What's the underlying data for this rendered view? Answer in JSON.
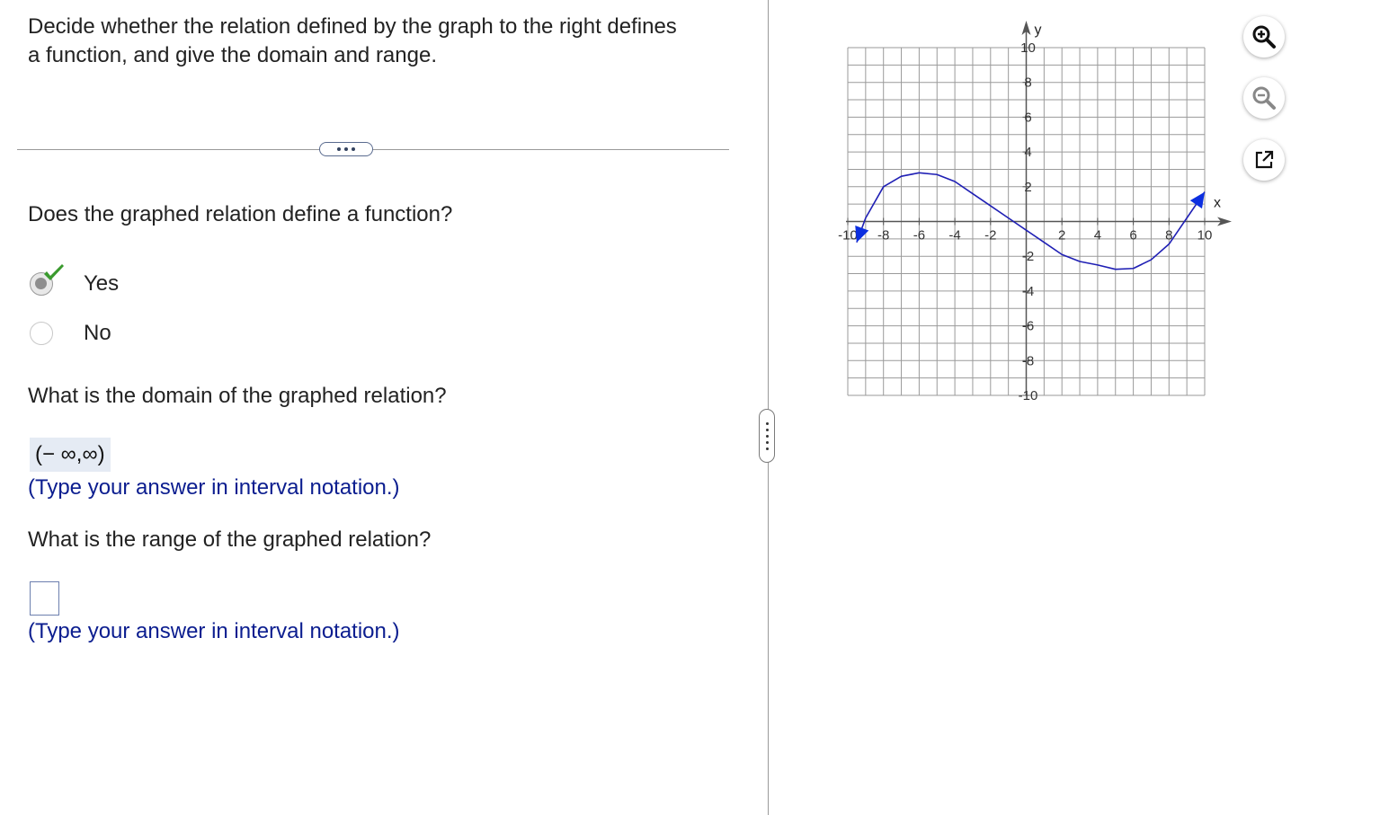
{
  "question": {
    "text": "Decide whether the relation defined by the graph to the right defines a function, and give the domain and range."
  },
  "part1": {
    "prompt": "Does the graphed relation define a function?",
    "options": [
      {
        "label": "Yes",
        "selected": true,
        "correct": true
      },
      {
        "label": "No",
        "selected": false
      }
    ]
  },
  "part2": {
    "prompt": "What is the domain of the graphed relation?",
    "answer": "(− ∞,∞)",
    "hint": "(Type your answer in interval notation.)"
  },
  "part3": {
    "prompt": "What is the range of the graphed relation?",
    "answer": "",
    "hint": "(Type your answer in interval notation.)"
  },
  "colors": {
    "curve": "#1f1fb4",
    "arrow": "#0c2fe0",
    "check": "#3a9a2e",
    "hint_text": "#0b1d8f",
    "answer_bg": "#e5ebf4"
  },
  "icons": [
    "zoom-in-icon",
    "zoom-out-icon",
    "popout-icon",
    "checkmark-icon"
  ],
  "graph": {
    "xlabel": "x",
    "ylabel": "y",
    "xlim": [
      -10,
      10
    ],
    "ylim": [
      -10,
      10
    ],
    "grid": true,
    "x_ticks": [
      "-10",
      "-8",
      "-6",
      "-4",
      "-2",
      "2",
      "4",
      "6",
      "8",
      "10"
    ],
    "y_ticks": [
      "10",
      "8",
      "6",
      "4",
      "2",
      "-2",
      "-4",
      "-6",
      "-8",
      "-10"
    ],
    "curve_points": [
      [
        -9.5,
        -1.2
      ],
      [
        -9,
        0.2
      ],
      [
        -8,
        2.0
      ],
      [
        -7,
        2.6
      ],
      [
        -6,
        2.8
      ],
      [
        -5,
        2.7
      ],
      [
        -4,
        2.3
      ],
      [
        -3,
        1.6
      ],
      [
        -2,
        0.9
      ],
      [
        -1,
        0.2
      ],
      [
        0,
        -0.5
      ],
      [
        1,
        -1.2
      ],
      [
        2,
        -1.9
      ],
      [
        3,
        -2.3
      ],
      [
        4,
        -2.5
      ],
      [
        5,
        -2.75
      ],
      [
        6,
        -2.7
      ],
      [
        7,
        -2.2
      ],
      [
        8,
        -1.3
      ],
      [
        9,
        0.2
      ],
      [
        10,
        1.7
      ]
    ],
    "end_arrows": "both"
  }
}
